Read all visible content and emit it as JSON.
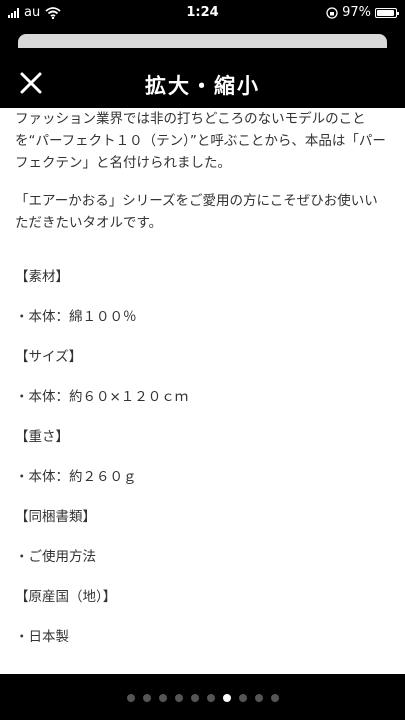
{
  "status": {
    "carrier": "au",
    "time": "1:24",
    "battery": "97%",
    "battery_level": 0.97
  },
  "header": {
    "title": "拡大・縮小",
    "close_icon": "close-icon"
  },
  "content": {
    "intro_1": "ファッション業界では非の打ちどころのないモデルのことを“パーフェクト１０（テン）”と呼ぶことから、本品は「パーフェクテン」と名付けられました。",
    "intro_2": "「エアーかおる」シリーズをご愛用の方にこそぜひお使いいただきたいタオルです。",
    "material_heading": "【素材】",
    "material_value": "・本体：綿１００％",
    "size_heading": "【サイズ】",
    "size_value": "・本体：約６０×１２０ｃｍ",
    "weight_heading": "【重さ】",
    "weight_value": "・本体：約２６０ｇ",
    "docs_heading": "【同梱書類】",
    "docs_value": "・ご使用方法",
    "origin_heading": "【原産国（地）】",
    "origin_value": "・日本製"
  },
  "pagination": {
    "total": 10,
    "active_index": 6
  }
}
